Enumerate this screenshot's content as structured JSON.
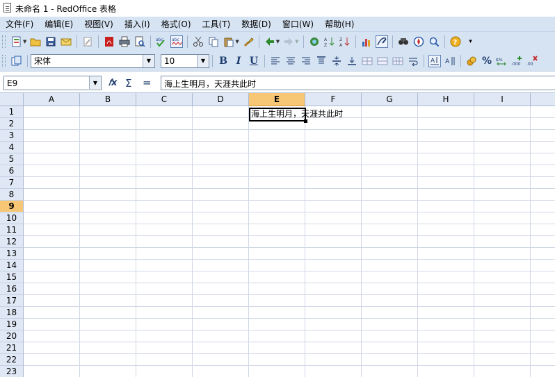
{
  "window": {
    "title": "未命名 1 - RedOffice 表格"
  },
  "menu": [
    "文件(F)",
    "编辑(E)",
    "视图(V)",
    "插入(I)",
    "格式(O)",
    "工具(T)",
    "数据(D)",
    "窗口(W)",
    "帮助(H)"
  ],
  "toolbar2": {
    "font_name": "宋体",
    "font_size": "10",
    "bold": "B",
    "italic": "I",
    "underline": "U",
    "percent": "%"
  },
  "formula_bar": {
    "name_box": "E9",
    "formula": "海上生明月，天涯共此时"
  },
  "sheet": {
    "columns": [
      "A",
      "B",
      "C",
      "D",
      "E",
      "F",
      "G",
      "H",
      "I"
    ],
    "rows": [
      "1",
      "2",
      "3",
      "4",
      "5",
      "6",
      "7",
      "8",
      "9",
      "10",
      "11",
      "12",
      "13",
      "14",
      "15",
      "16",
      "17",
      "18",
      "19",
      "20",
      "21",
      "22",
      "23"
    ],
    "active_column": "E",
    "active_row": "9",
    "cell_E9": "海上生明月，天涯共此时"
  },
  "colors": {
    "chrome": "#d6e3f3",
    "header": "#dfe8f4",
    "active_header": "#f8c775",
    "gridline": "#d0d7e5"
  }
}
